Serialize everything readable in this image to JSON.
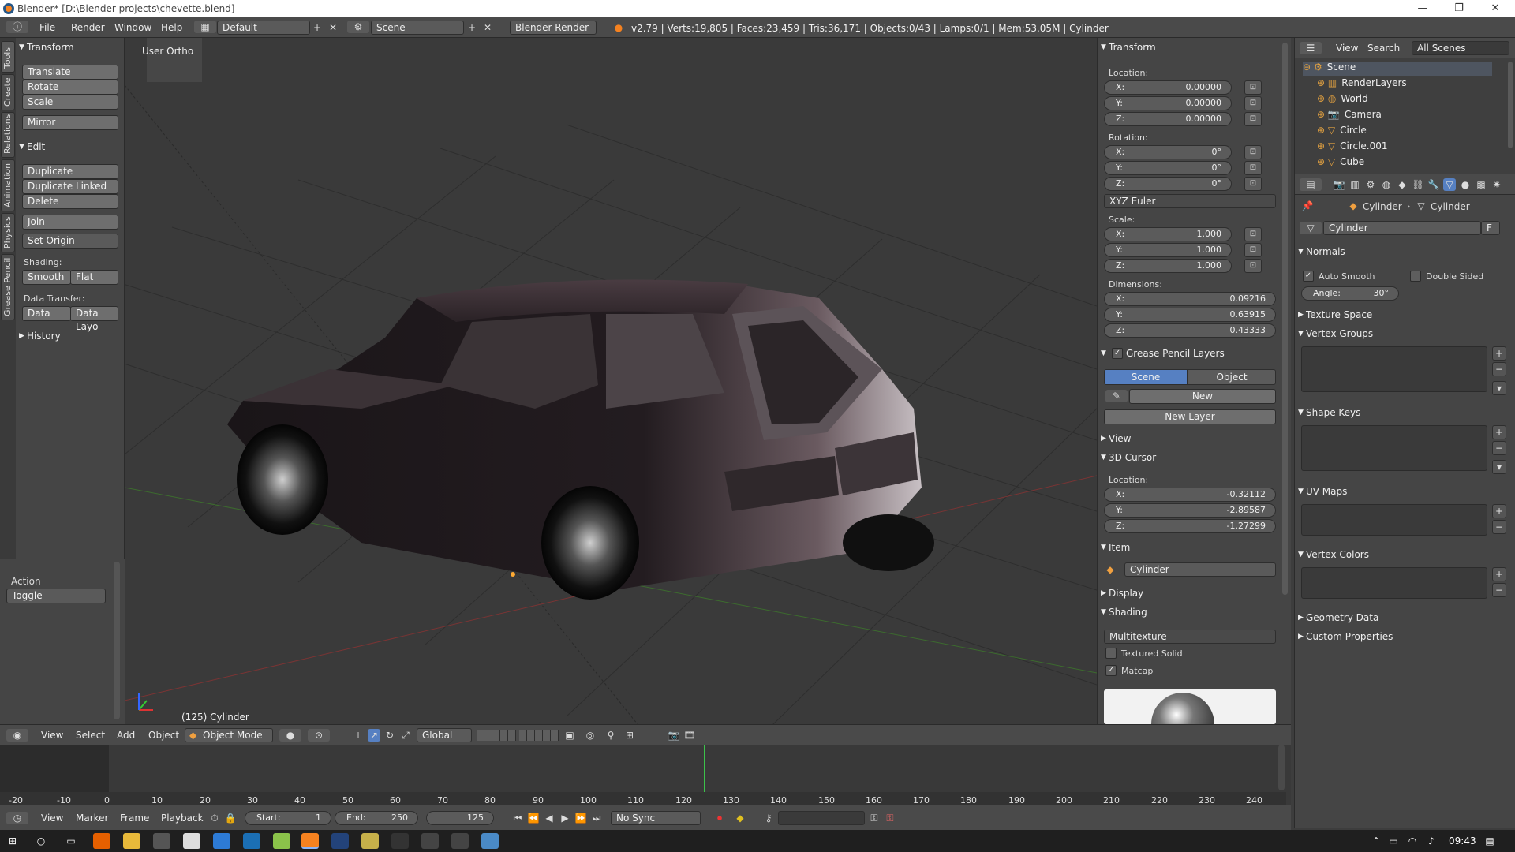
{
  "window": {
    "title": "Blender* [D:\\Blender projects\\chevette.blend]",
    "minimize": "—",
    "restore": "❐",
    "close": "✕"
  },
  "menu": {
    "items": [
      "File",
      "Render",
      "Window",
      "Help"
    ],
    "layout": "Default",
    "scene": "Scene",
    "engine": "Blender Render",
    "stats": "v2.79 | Verts:19,805 | Faces:23,459 | Tris:36,171 | Objects:0/43 | Lamps:0/1 | Mem:53.05M | Cylinder"
  },
  "tool_tabs": [
    "Tools",
    "Create",
    "Relations",
    "Animation",
    "Physics",
    "Grease Pencil"
  ],
  "tool_shelf": {
    "transform_title": "Transform",
    "translate": "Translate",
    "rotate": "Rotate",
    "scale": "Scale",
    "mirror": "Mirror",
    "edit_title": "Edit",
    "duplicate": "Duplicate",
    "duplicate_linked": "Duplicate Linked",
    "delete": "Delete",
    "join": "Join",
    "set_origin": "Set Origin",
    "shading_label": "Shading:",
    "smooth": "Smooth",
    "flat": "Flat",
    "data_transfer_label": "Data Transfer:",
    "data": "Data",
    "data_layout": "Data Layo",
    "history_title": "History"
  },
  "operator": {
    "title": "Action",
    "value": "Toggle"
  },
  "viewport": {
    "view_name": "User Ortho",
    "object_label": "(125) Cylinder"
  },
  "n_panel": {
    "transform_title": "Transform",
    "location_label": "Location:",
    "location": [
      {
        "k": "X:",
        "v": "0.00000"
      },
      {
        "k": "Y:",
        "v": "0.00000"
      },
      {
        "k": "Z:",
        "v": "0.00000"
      }
    ],
    "rotation_label": "Rotation:",
    "rotation": [
      {
        "k": "X:",
        "v": "0°"
      },
      {
        "k": "Y:",
        "v": "0°"
      },
      {
        "k": "Z:",
        "v": "0°"
      }
    ],
    "rotation_mode": "XYZ Euler",
    "scale_label": "Scale:",
    "scale": [
      {
        "k": "X:",
        "v": "1.000"
      },
      {
        "k": "Y:",
        "v": "1.000"
      },
      {
        "k": "Z:",
        "v": "1.000"
      }
    ],
    "dimensions_label": "Dimensions:",
    "dimensions": [
      {
        "k": "X:",
        "v": "0.09216"
      },
      {
        "k": "Y:",
        "v": "0.63915"
      },
      {
        "k": "Z:",
        "v": "0.43333"
      }
    ],
    "grease_title": "Grease Pencil Layers",
    "gp_scene": "Scene",
    "gp_object": "Object",
    "gp_new": "New",
    "gp_new_layer": "New Layer",
    "view_title": "View",
    "cursor_title": "3D Cursor",
    "cursor_location_label": "Location:",
    "cursor": [
      {
        "k": "X:",
        "v": "-0.32112"
      },
      {
        "k": "Y:",
        "v": "-2.89587"
      },
      {
        "k": "Z:",
        "v": "-1.27299"
      }
    ],
    "item_title": "Item",
    "item_name": "Cylinder",
    "display_title": "Display",
    "shading_title": "Shading",
    "shading_mode": "Multitexture",
    "textured_solid": "Textured Solid",
    "matcap": "Matcap"
  },
  "outliner": {
    "view": "View",
    "search": "Search",
    "filter": "All Scenes",
    "items": [
      {
        "name": "Scene",
        "indent": 0
      },
      {
        "name": "RenderLayers",
        "indent": 1
      },
      {
        "name": "World",
        "indent": 1
      },
      {
        "name": "Camera",
        "indent": 1
      },
      {
        "name": "Circle",
        "indent": 1
      },
      {
        "name": "Circle.001",
        "indent": 1
      },
      {
        "name": "Cube",
        "indent": 1
      }
    ]
  },
  "properties": {
    "breadcrumb_obj": "Cylinder",
    "breadcrumb_data": "Cylinder",
    "datablock": "Cylinder",
    "fake_user": "F",
    "normals_title": "Normals",
    "auto_smooth": "Auto Smooth",
    "double_sided": "Double Sided",
    "angle_label": "Angle:",
    "angle_value": "30°",
    "texture_space": "Texture Space",
    "vertex_groups": "Vertex Groups",
    "shape_keys": "Shape Keys",
    "uv_maps": "UV Maps",
    "vertex_colors": "Vertex Colors",
    "geometry_data": "Geometry Data",
    "custom_properties": "Custom Properties"
  },
  "view_header": {
    "view": "View",
    "select": "Select",
    "add": "Add",
    "object": "Object",
    "mode": "Object Mode",
    "orientation": "Global"
  },
  "timeline": {
    "ticks": [
      "-20",
      "-10",
      "0",
      "10",
      "20",
      "30",
      "40",
      "50",
      "60",
      "70",
      "80",
      "90",
      "100",
      "110",
      "120",
      "130",
      "140",
      "150",
      "160",
      "170",
      "180",
      "190",
      "200",
      "210",
      "220",
      "230",
      "240"
    ],
    "current_frame": 125,
    "view": "View",
    "marker": "Marker",
    "frame": "Frame",
    "playback": "Playback",
    "start": "Start:",
    "start_value": "1",
    "end": "End:",
    "end_value": "250",
    "frame_value": "125",
    "sync": "No Sync"
  },
  "taskbar": {
    "time": "09:43"
  }
}
